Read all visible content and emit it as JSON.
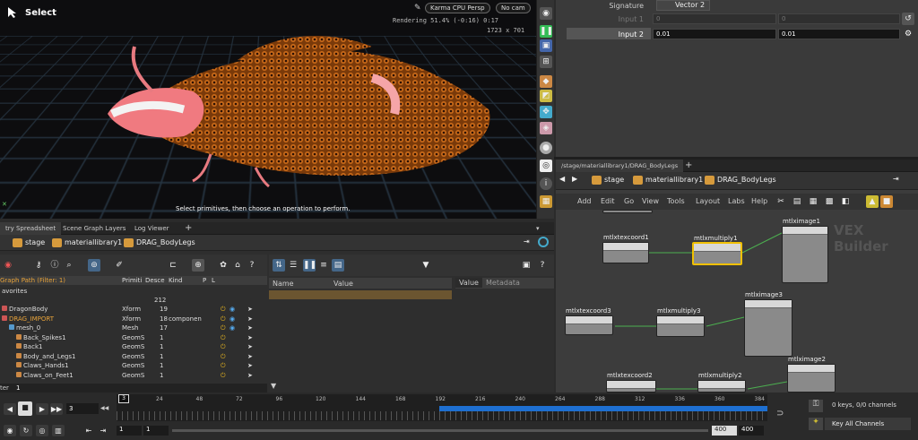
{
  "viewport": {
    "tool_label": "Select",
    "renderer": "Karma CPU",
    "camera_menu": "Persp",
    "no_cam": "No cam",
    "rendering": "Rendering  51.4%  (-0:16)  0:17",
    "resolution": "1723 x 701",
    "hint": "Select primitives, then choose an operation to perform."
  },
  "params": {
    "signature_label": "Signature",
    "signature_value": "Vector 2",
    "input1_label": "Input 1",
    "input1_x": "0",
    "input1_y": "0",
    "input2_label": "Input 2",
    "input2_x": "0.01",
    "input2_y": "0.01"
  },
  "spreadsheet": {
    "tabs": [
      "try Spreadsheet",
      "Scene Graph Layers",
      "Log Viewer"
    ],
    "path": [
      "stage",
      "materiallibrary1",
      "DRAG_BodyLegs"
    ],
    "filter_label": "Graph Path (Filter: 1)",
    "favorites": "avorites",
    "col_prim": "Primiti",
    "col_desc": "Desce",
    "col_kind": "Kind",
    "col_p": "P",
    "col_l": "L",
    "total": "212",
    "rows": [
      {
        "name": "DragonBody",
        "prim": "Xform",
        "desc": "19",
        "kind": ""
      },
      {
        "name": "DRAG_IMPORT",
        "prim": "Xform",
        "desc": "18",
        "kind": "componen"
      },
      {
        "name": "mesh_0",
        "prim": "Mesh",
        "desc": "17",
        "kind": ""
      },
      {
        "name": "Back_Spikes1",
        "prim": "GeomS",
        "desc": "1",
        "kind": ""
      },
      {
        "name": "Back1",
        "prim": "GeomS",
        "desc": "1",
        "kind": ""
      },
      {
        "name": "Body_and_Legs1",
        "prim": "GeomS",
        "desc": "1",
        "kind": ""
      },
      {
        "name": "Claws_Hands1",
        "prim": "GeomS",
        "desc": "1",
        "kind": ""
      },
      {
        "name": "Claws_on_Feet1",
        "prim": "GeomS",
        "desc": "1",
        "kind": ""
      }
    ],
    "col_name": "Name",
    "col_value": "Value",
    "tab_value": "Value",
    "tab_metadata": "Metadata",
    "bottom_label": "ter",
    "bottom_value": "1"
  },
  "network": {
    "path": "/stage/materiallibrary1/DRAG_BodyLegs",
    "crumbs": [
      "stage",
      "materiallibrary1",
      "DRAG_BodyLegs"
    ],
    "menu": [
      "Add",
      "Edit",
      "Go",
      "View",
      "Tools",
      "Layout",
      "Labs",
      "Help"
    ],
    "watermark": "VEX Builder",
    "nodes": {
      "n1": "mtlxtexcoord1",
      "n2": "mtlxmultiply1",
      "n3": "mtlximage1",
      "n4": "mtlxtexcoord3",
      "n5": "mtlxmultiply3",
      "n6": "mtlximage3",
      "n7": "mtlxtexcoord2",
      "n8": "mtlxmultiply2",
      "n9": "mtlximage2"
    }
  },
  "timeline": {
    "ticks": [
      "24",
      "48",
      "72",
      "96",
      "120",
      "144",
      "168",
      "192",
      "216",
      "240",
      "264",
      "288",
      "312",
      "336",
      "360",
      "384"
    ],
    "frame_marker": "3",
    "current_frame": "3",
    "start1": "1",
    "start2": "1",
    "end1": "400",
    "end2": "400",
    "keys": "0 keys, 0/0 channels",
    "key_all": "Key All Channels",
    "accent": "#1e6fd0"
  }
}
